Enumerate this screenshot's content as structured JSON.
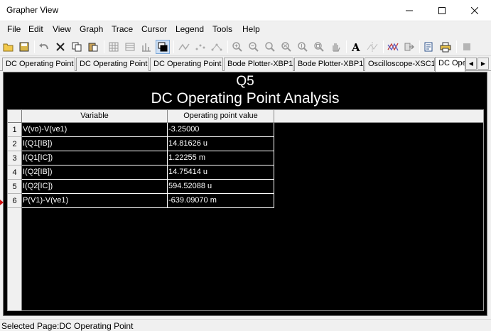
{
  "window": {
    "title": "Grapher View",
    "controls": {
      "minimize": "minimize-icon",
      "maximize": "maximize-icon",
      "close": "close-icon"
    }
  },
  "menu": [
    "File",
    "Edit",
    "View",
    "Graph",
    "Trace",
    "Cursor",
    "Legend",
    "Tools",
    "Help"
  ],
  "toolbar_icons": [
    "open-folder-icon",
    "save-icon",
    "undo-icon",
    "cut-icon",
    "copy-icon",
    "paste-icon",
    "grid-icon",
    "table-icon",
    "bars-icon",
    "overlay-icon",
    "trace-line-icon",
    "trace-points-icon",
    "trace-both-icon",
    "zoom-in-icon",
    "zoom-out-icon",
    "zoom-fit-icon",
    "zoom-x-icon",
    "zoom-y-icon",
    "zoom-all-icon",
    "pan-hand-icon",
    "font-icon",
    "cursor-icon",
    "overlay-traces-icon",
    "export-icon",
    "print-preview-icon",
    "print-icon",
    "stop-icon"
  ],
  "tabs": [
    "DC Operating Point",
    "DC Operating Point",
    "DC Operating Point",
    "Bode Plotter-XBP1",
    "Bode Plotter-XBP1",
    "Oscilloscope-XSC1",
    "DC Ope"
  ],
  "page": {
    "title_line1": "Q5",
    "title_line2": "DC Operating Point Analysis"
  },
  "table": {
    "headers": [
      "Variable",
      "Operating point value"
    ],
    "rows": [
      {
        "num": "1",
        "variable": "V(vo)-V(ve1)",
        "value": "-3.25000"
      },
      {
        "num": "2",
        "variable": "I(Q1[IB])",
        "value": "14.81626 u"
      },
      {
        "num": "3",
        "variable": "I(Q1[IC])",
        "value": "1.22255 m"
      },
      {
        "num": "4",
        "variable": "I(Q2[IB])",
        "value": "14.75414 u"
      },
      {
        "num": "5",
        "variable": "I(Q2[IC])",
        "value": "594.52088 u"
      },
      {
        "num": "6",
        "variable": "P(V1)-V(ve1)",
        "value": "-639.09070 m"
      }
    ]
  },
  "status": "Selected Page:DC Operating Point",
  "colors": {
    "canvas_bg": "#000000",
    "canvas_text": "#ffffff",
    "chrome_bg": "#f0f0f0"
  }
}
